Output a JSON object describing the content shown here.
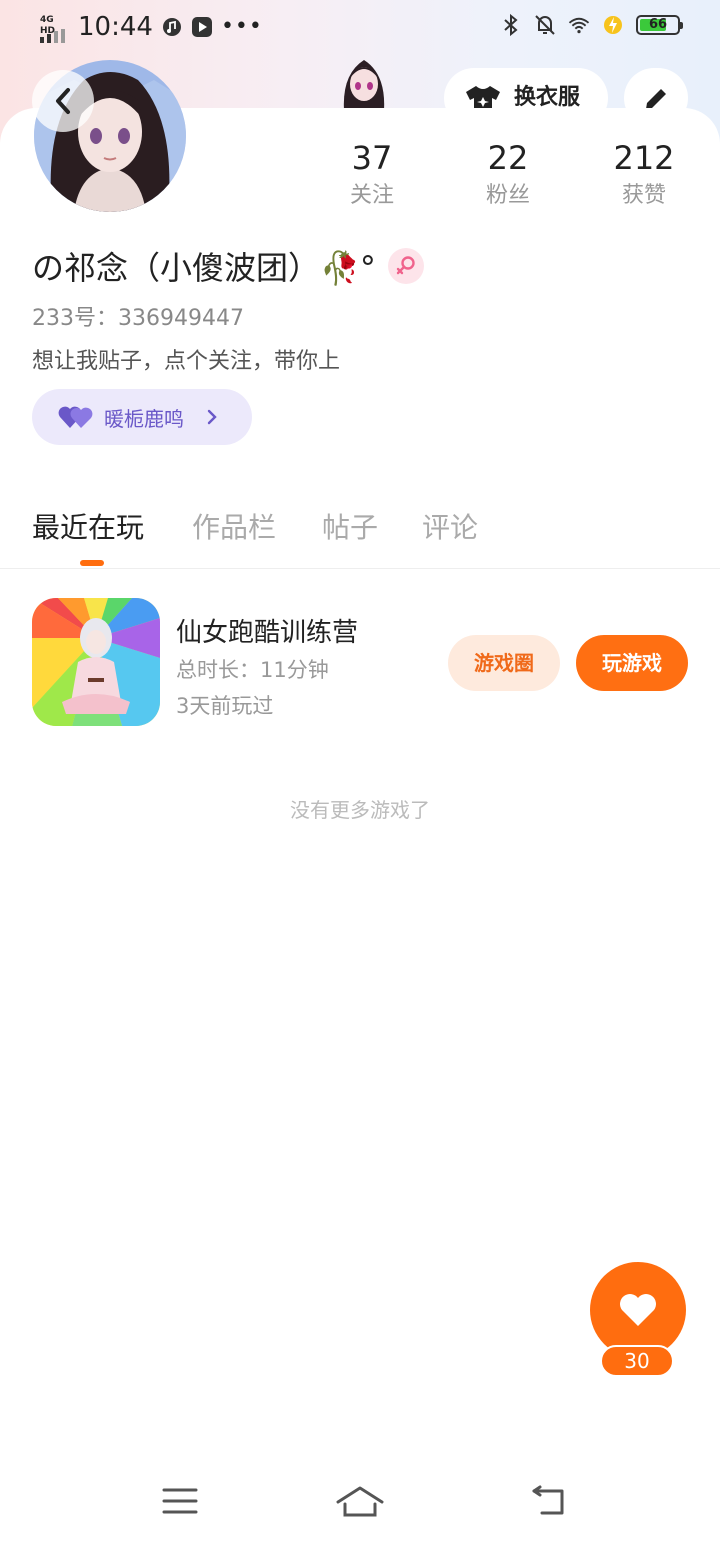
{
  "status_bar": {
    "network": "4G HD",
    "time": "10:44",
    "battery": "66",
    "icons": [
      "music-icon",
      "video-icon",
      "more-dots-icon",
      "bluetooth-icon",
      "mute-bell-icon",
      "wifi-icon",
      "charging-icon",
      "battery-icon"
    ]
  },
  "header": {
    "outfit_label": "换衣服",
    "icons": [
      "back-arrow-icon",
      "tshirt-icon",
      "pen-edit-icon"
    ]
  },
  "stats": {
    "following_num": "37",
    "following_label": "关注",
    "fans_num": "22",
    "fans_label": "粉丝",
    "likes_num": "212",
    "likes_label": "获赞"
  },
  "profile": {
    "name": "の祁念（小傻波团）🥀°",
    "gender": "female",
    "uid": "233号：336949447",
    "bio": "想让我贴子，点个关注，带你上",
    "guild_name": "暖栀鹿鸣"
  },
  "tabs": [
    {
      "label": "最近在玩",
      "active": true
    },
    {
      "label": "作品栏",
      "active": false
    },
    {
      "label": "帖子",
      "active": false
    },
    {
      "label": "评论",
      "active": false
    }
  ],
  "games": [
    {
      "name": "仙女跑酷训练营",
      "duration": "总时长：11分钟",
      "last_played": "3天前玩过",
      "circle_label": "游戏圈",
      "play_label": "玩游戏"
    }
  ],
  "empty_hint": "没有更多游戏了",
  "fab": {
    "count": "30"
  },
  "colors": {
    "accent": "#ff6d0f",
    "guild_bg": "#ece9fb",
    "guild_text": "#6a58c8"
  },
  "navbar": {
    "icons": [
      "menu-icon",
      "home-icon",
      "back-icon"
    ]
  }
}
